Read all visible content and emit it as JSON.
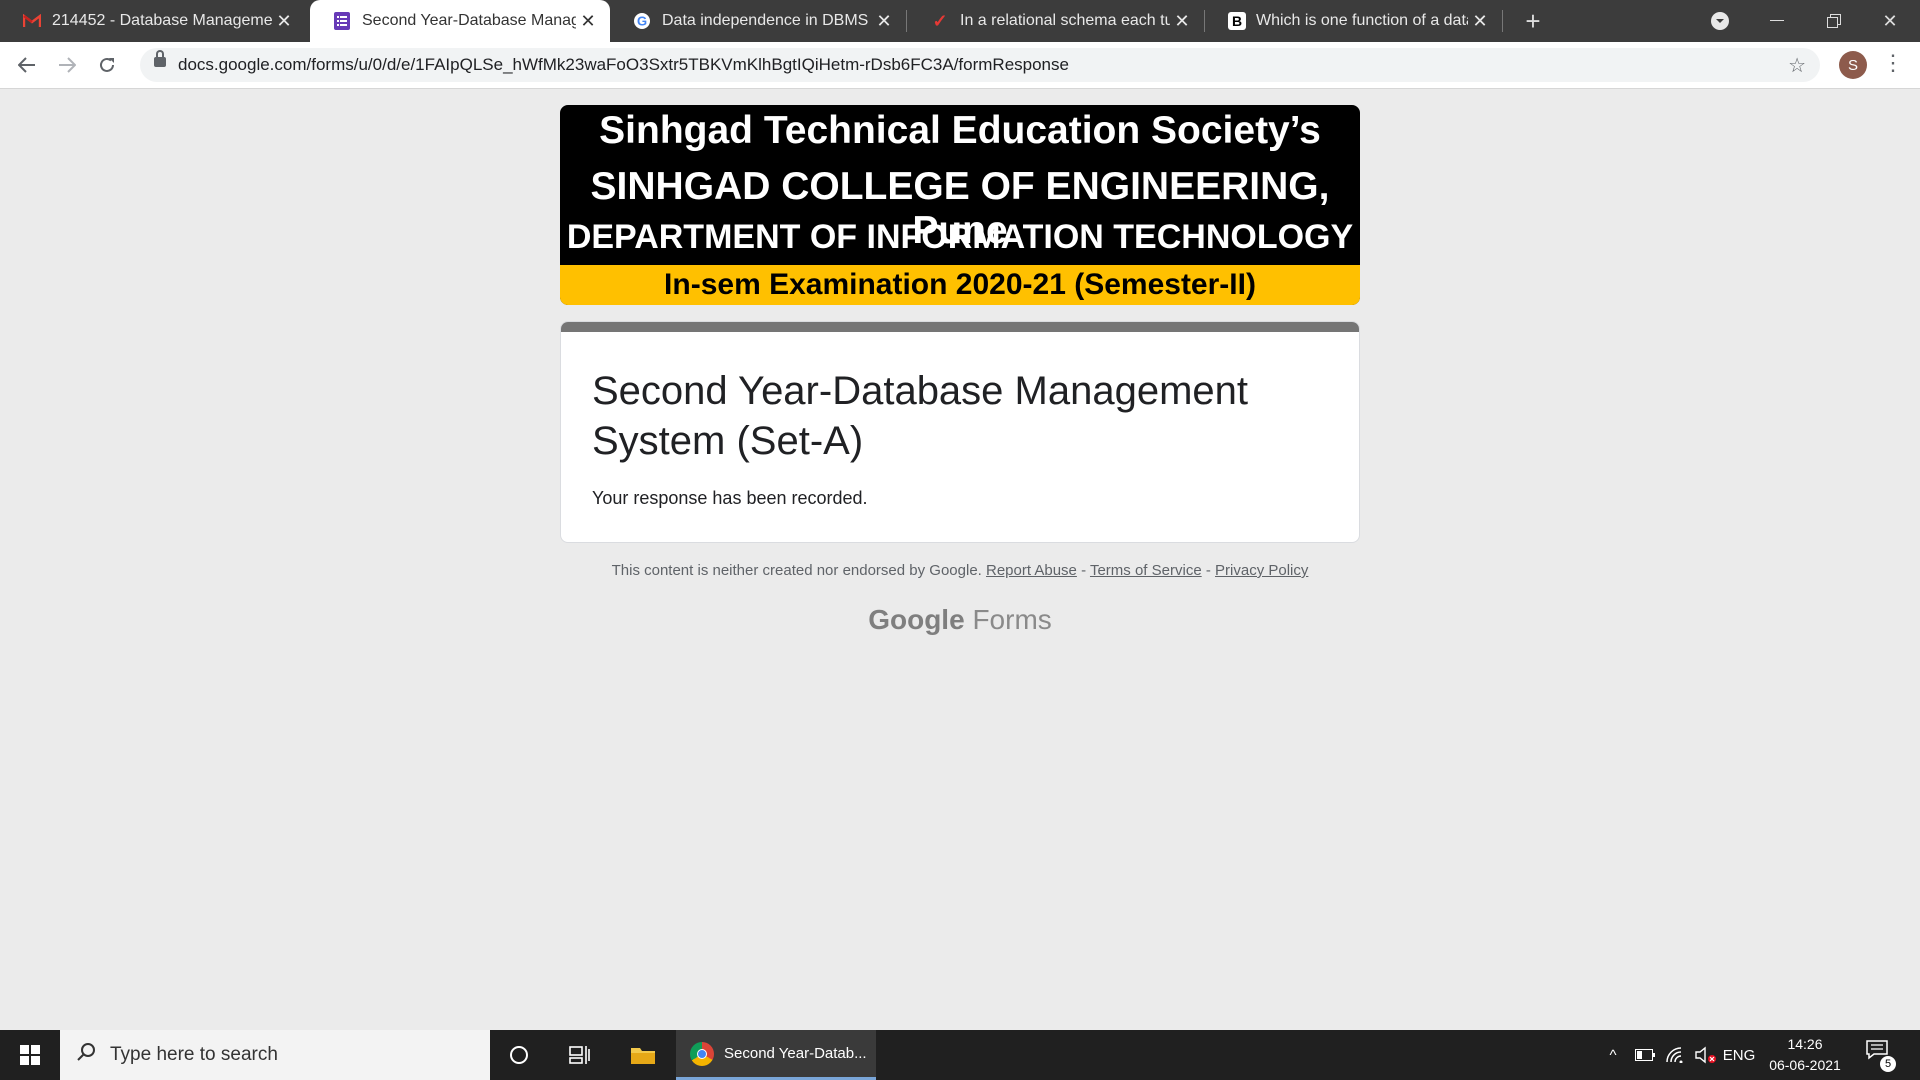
{
  "browser": {
    "tabs": [
      {
        "title": "214452 - Database Management",
        "icon": "gmail-icon"
      },
      {
        "title": "Second Year-Database Managem",
        "icon": "google-forms-icon"
      },
      {
        "title": "Data independence in DBMS is k",
        "icon": "google-icon"
      },
      {
        "title": "In a relational schema each tuple",
        "icon": "red-checkmark-icon"
      },
      {
        "title": "Which is one function of a datab",
        "icon": "b-logo-icon"
      }
    ],
    "active_tab": 1,
    "new_tab_label": "+",
    "url": "docs.google.com/forms/u/0/d/e/1FAIpQLSe_hWfMk23waFoO3Sxtr5TBKVmKlhBgtIQiHetm-rDsb6FC3A/formResponse",
    "profile_initial": "S"
  },
  "banner": {
    "line1": "Sinhgad Technical Education Society’s",
    "line2": "SINHGAD COLLEGE OF ENGINEERING, Pune",
    "line3": "DEPARTMENT OF INFORMATION TECHNOLOGY",
    "line4": "In-sem Examination 2020-21 (Semester-II)",
    "colors": {
      "background": "#000000",
      "strip": "#ffc000"
    }
  },
  "form": {
    "title": "Second Year-Database Management System (Set-A)",
    "message": "Your response has been recorded."
  },
  "footer": {
    "disclaimer": "This content is neither created nor endorsed by Google.",
    "report_abuse": "Report Abuse",
    "sep1": " - ",
    "terms": "Terms of Service",
    "sep2": " - ",
    "privacy": "Privacy Policy",
    "brand_google": "Google",
    "brand_forms": "Forms"
  },
  "taskbar": {
    "search_placeholder": "Type here to search",
    "app_label": "Second Year-Datab...",
    "language": "ENG",
    "time": "14:26",
    "date": "06-06-2021",
    "notification_count": "5"
  }
}
